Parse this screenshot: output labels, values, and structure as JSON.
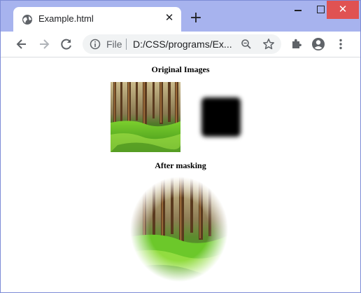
{
  "browser": {
    "tab_title": "Example.html",
    "tab_close_glyph": "✕",
    "new_tab_glyph": "+",
    "minimize_glyph": "",
    "close_glyph": "✕",
    "omnibox": {
      "scheme": "File",
      "url": "D:/CSS/programs/Ex..."
    },
    "icons": {
      "tab": "globe-icon",
      "back": "arrow-left-icon",
      "forward": "arrow-right-icon",
      "reload": "reload-icon",
      "info": "info-icon",
      "zoom": "zoom-out-icon",
      "bookmark": "star-icon",
      "extensions": "puzzle-icon",
      "profile": "account-icon",
      "menu": "kebab-menu-icon"
    },
    "colors": {
      "frame": "#a7b3ee",
      "close_button": "#e05252",
      "omnibox_bg": "#f1f3f4"
    }
  },
  "page": {
    "heading_original": "Original Images",
    "heading_after": "After masking"
  }
}
